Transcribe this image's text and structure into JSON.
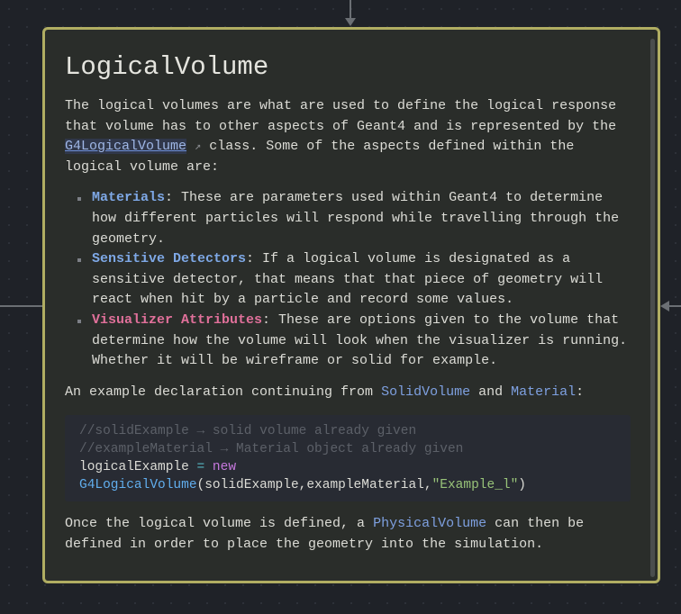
{
  "title": "LogicalVolume",
  "intro": {
    "p1": "The logical volumes are what are used to define the logical response that volume has to other aspects of Geant4 and is represented by the ",
    "link": "G4LogicalVolume",
    "p2": " class. Some of the aspects defined within the logical volume are:"
  },
  "bullets": [
    {
      "term": "Materials",
      "text": ": These are parameters used within Geant4 to determine how different particles will respond while travelling through the geometry."
    },
    {
      "term": "Sensitive Detectors",
      "text": ": If a logical volume is designated as a sensitive detector, that means that that piece of geometry will react when hit by a particle and record some values."
    },
    {
      "term": "Visualizer Attributes",
      "text": ": These are options given to the volume that determine how the volume will look when the visualizer is running. Whether it will be wireframe or solid for example."
    }
  ],
  "example": {
    "pre": "An example declaration continuing from ",
    "link1": "SolidVolume",
    "mid": " and ",
    "link2": "Material",
    "post": ":"
  },
  "code": {
    "c1": "//solidExample → solid volume already given",
    "c2": "//exampleMaterial → Material object already given",
    "l3a": "logicalExample ",
    "l3op": "=",
    "l3kw": " new",
    "l4fn": "G4LogicalVolume",
    "l4args": "(solidExample,exampleMaterial,",
    "l4str": "\"Example_l\"",
    "l4end": ")"
  },
  "outro": {
    "pre": "Once the logical volume is defined, a ",
    "link": "PhysicalVolume",
    "post": " can then be defined in order to place the geometry into the simulation."
  },
  "colors": {
    "border": "#b0ad62",
    "background": "#2a2d2a"
  }
}
